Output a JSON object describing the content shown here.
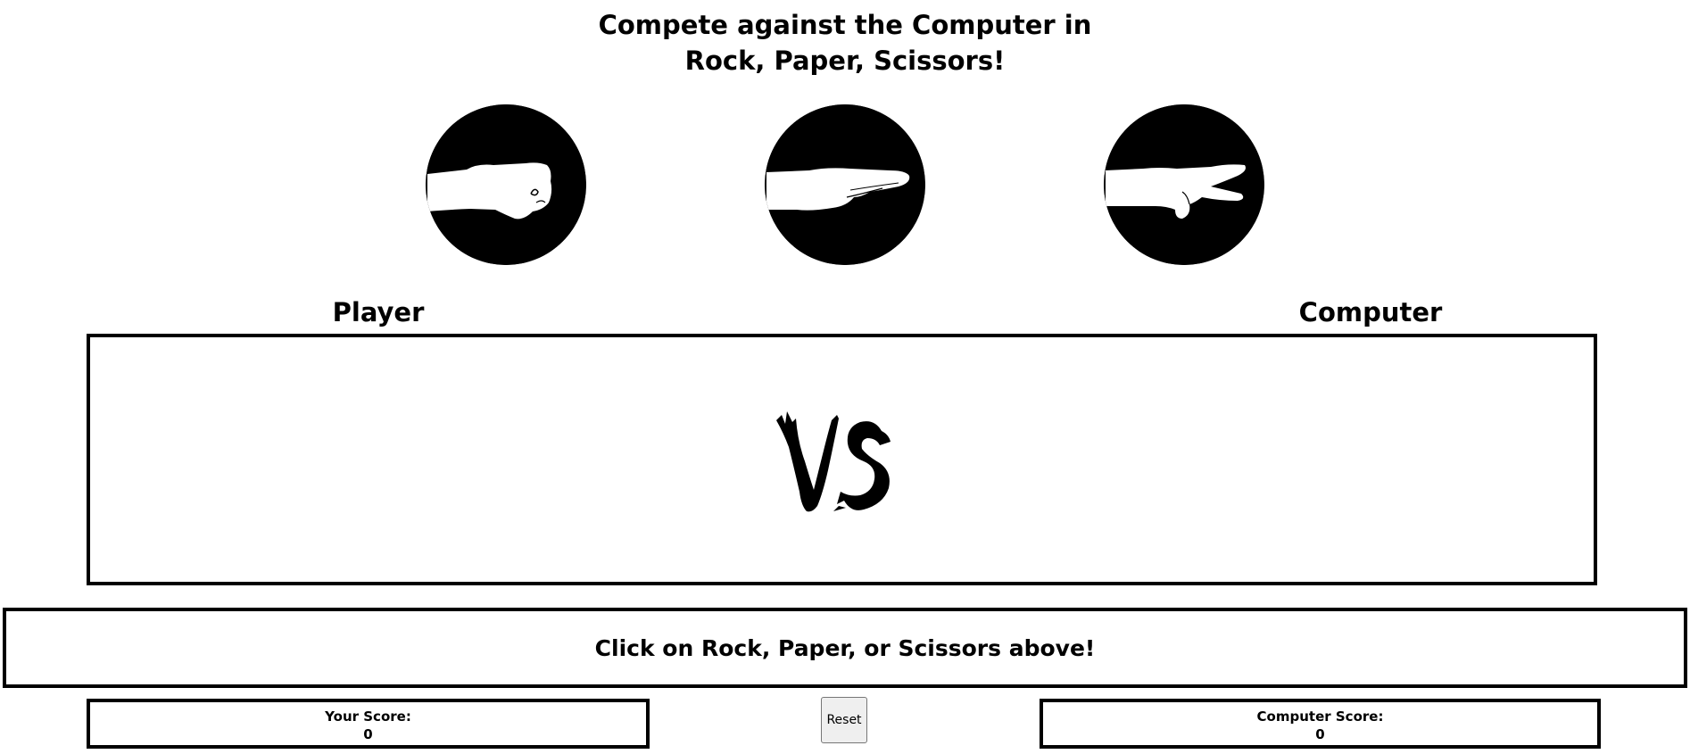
{
  "header": {
    "title_line1": "Compete against the Computer in",
    "title_line2": "Rock, Paper, Scissors!"
  },
  "choices": [
    {
      "id": "rock",
      "icon": "rock-fist-icon"
    },
    {
      "id": "paper",
      "icon": "paper-flat-hand-icon"
    },
    {
      "id": "scissors",
      "icon": "scissors-two-fingers-icon"
    }
  ],
  "arena": {
    "player_label": "Player",
    "computer_label": "Computer",
    "vs_text": "VS"
  },
  "message": "Click on Rock, Paper, or Scissors above!",
  "scores": {
    "player_label": "Your Score:",
    "player_value": "0",
    "computer_label": "Computer Score:",
    "computer_value": "0"
  },
  "controls": {
    "reset_label": "Reset"
  },
  "colors": {
    "foreground": "#000000",
    "background": "#ffffff"
  }
}
